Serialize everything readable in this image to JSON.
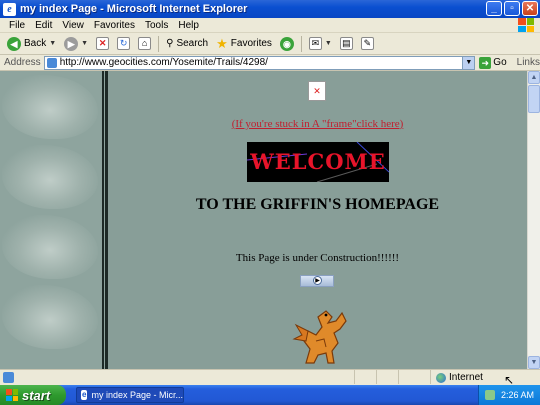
{
  "window": {
    "title": "my index Page - Microsoft Internet Explorer",
    "buttons": [
      "_",
      "▫",
      "✕"
    ]
  },
  "menu": [
    "File",
    "Edit",
    "View",
    "Favorites",
    "Tools",
    "Help"
  ],
  "toolbar": {
    "back_label": "Back",
    "search_label": "Search",
    "favorites_label": "Favorites"
  },
  "address": {
    "label": "Address",
    "url": "http://www.geocities.com/Yosemite/Trails/4298/",
    "go_label": "Go",
    "links_label": "Links"
  },
  "page": {
    "frame_link": "(If you're stuck in A \"frame\"click here)",
    "welcome_banner": "WELCOME",
    "heading": "TO THE GRIFFIN'S HOMEPAGE",
    "construction_text": "This Page is under Construction!!!!!!"
  },
  "status": {
    "zone_label": "Internet"
  },
  "taskbar": {
    "start_label": "start",
    "task_label": "my index Page - Micr...",
    "clock": "2:26 AM"
  },
  "colors": {
    "page_background": "#889e98",
    "link_color": "#c02030",
    "welcome_text": "#e8142a",
    "titlebar_blue": "#0a4fd0"
  }
}
